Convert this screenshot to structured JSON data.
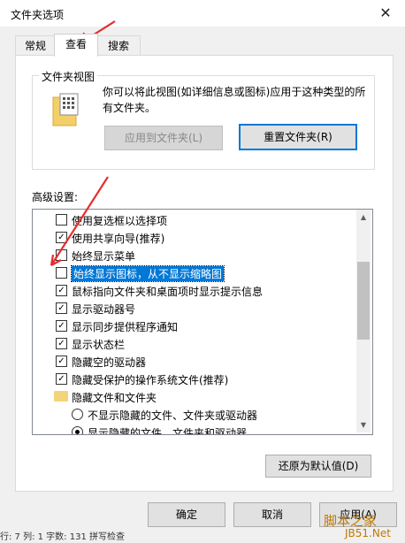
{
  "window": {
    "title": "文件夹选项",
    "close_glyph": "✕"
  },
  "tabs": [
    {
      "label": "常规",
      "active": false
    },
    {
      "label": "查看",
      "active": true
    },
    {
      "label": "搜索",
      "active": false
    }
  ],
  "folder_views": {
    "group_label": "文件夹视图",
    "description": "你可以将此视图(如详细信息或图标)应用于这种类型的所有文件夹。",
    "apply_button": "应用到文件夹(L)",
    "reset_button": "重置文件夹(R)"
  },
  "advanced": {
    "label": "高级设置:",
    "items": [
      {
        "kind": "checkbox",
        "checked": false,
        "text": "使用复选框以选择项"
      },
      {
        "kind": "checkbox",
        "checked": true,
        "text": "使用共享向导(推荐)"
      },
      {
        "kind": "checkbox",
        "checked": false,
        "text": "始终显示菜单"
      },
      {
        "kind": "checkbox",
        "checked": false,
        "text": "始终显示图标，从不显示缩略图",
        "selected": true
      },
      {
        "kind": "checkbox",
        "checked": true,
        "text": "鼠标指向文件夹和桌面项时显示提示信息"
      },
      {
        "kind": "checkbox",
        "checked": true,
        "text": "显示驱动器号"
      },
      {
        "kind": "checkbox",
        "checked": true,
        "text": "显示同步提供程序通知"
      },
      {
        "kind": "checkbox",
        "checked": true,
        "text": "显示状态栏"
      },
      {
        "kind": "checkbox",
        "checked": true,
        "text": "隐藏空的驱动器"
      },
      {
        "kind": "checkbox",
        "checked": true,
        "text": "隐藏受保护的操作系统文件(推荐)"
      },
      {
        "kind": "folder",
        "text": "隐藏文件和文件夹"
      },
      {
        "kind": "radio",
        "checked": false,
        "text": "不显示隐藏的文件、文件夹或驱动器"
      },
      {
        "kind": "radio",
        "checked": true,
        "text": "显示隐藏的文件、文件夹和驱动器"
      }
    ],
    "restore_button": "还原为默认值(D)"
  },
  "footer": {
    "ok": "确定",
    "cancel": "取消",
    "apply": "应用(A)"
  },
  "background_strip": "行: 7  列: 1  字数: 131  拼写检查",
  "watermark": {
    "line1": "脚本之家",
    "line2": "JB51.Net"
  },
  "colors": {
    "accent": "#0078d7",
    "annotation": "#e62e2e"
  }
}
